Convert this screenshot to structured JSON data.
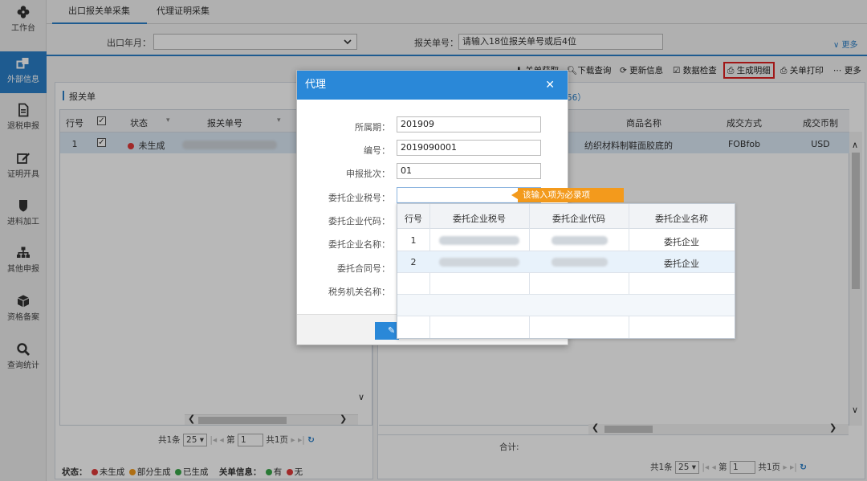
{
  "sidebar": {
    "items": [
      {
        "label": "工作台",
        "icon": "dashboard-icon"
      },
      {
        "label": "外部信息",
        "icon": "external-info-icon",
        "active": true
      },
      {
        "label": "退税申报",
        "icon": "document-icon"
      },
      {
        "label": "证明开具",
        "icon": "edit-icon"
      },
      {
        "label": "进料加工",
        "icon": "shield-icon"
      },
      {
        "label": "其他申报",
        "icon": "org-chart-icon"
      },
      {
        "label": "资格备案",
        "icon": "cube-icon"
      },
      {
        "label": "查询统计",
        "icon": "search-icon"
      }
    ]
  },
  "tabs": [
    "出口报关单采集",
    "代理证明采集"
  ],
  "filters": {
    "month_label": "出口年月：",
    "decl_label": "报关单号：",
    "decl_placeholder": "请输入18位报关单号或后4位",
    "more": "更多"
  },
  "toolbar": {
    "items": [
      "关单获取",
      "下载查询",
      "更新信息",
      "数据检查",
      "生成明细",
      "关单打印",
      "更多"
    ]
  },
  "left_panel": {
    "title": "报关单",
    "headers": [
      "行号",
      "状态",
      "报关单号"
    ],
    "row": {
      "num": "1",
      "status": "未生成"
    },
    "pager": {
      "total": "共1条",
      "size": "25",
      "page_prefix": "第",
      "page": "1",
      "pages": "共1页"
    }
  },
  "right_panel": {
    "title_suffix": "56）",
    "headers": [
      "商品名称",
      "成交方式",
      "成交币制"
    ],
    "row": {
      "goods": "纺织材料制鞋面胶底的",
      "deal": "FOBfob",
      "currency": "USD"
    },
    "sum_label": "合计:",
    "pager": {
      "total": "共1条",
      "size": "25",
      "page_prefix": "第",
      "page": "1",
      "pages": "共1页"
    }
  },
  "legend": {
    "status_label": "状态：",
    "s1": "未生成",
    "s2": "部分生成",
    "s3": "已生成",
    "info_label": "关单信息：",
    "i1": "有",
    "i2": "无",
    "colors": {
      "red": "#e03a3a",
      "orange": "#f39a1c",
      "green": "#3aa84a"
    }
  },
  "dialog": {
    "title": "代理",
    "fields": [
      {
        "label": "所属期：",
        "value": "201909"
      },
      {
        "label": "编号：",
        "value": "2019090001"
      },
      {
        "label": "申报批次：",
        "value": "01"
      },
      {
        "label": "委托企业税号：",
        "value": ""
      },
      {
        "label": "委托企业代码：",
        "value": ""
      },
      {
        "label": "委托企业名称：",
        "value": ""
      },
      {
        "label": "委托合同号：",
        "value": ""
      },
      {
        "label": "税务机关名称：",
        "value": ""
      }
    ],
    "tooltip": "该输入项为必录项"
  },
  "dropdown": {
    "headers": [
      "行号",
      "委托企业税号",
      "委托企业代码",
      "委托企业名称"
    ],
    "rows": [
      {
        "num": "1",
        "name": "委托企业"
      },
      {
        "num": "2",
        "name": "委托企业"
      }
    ]
  }
}
